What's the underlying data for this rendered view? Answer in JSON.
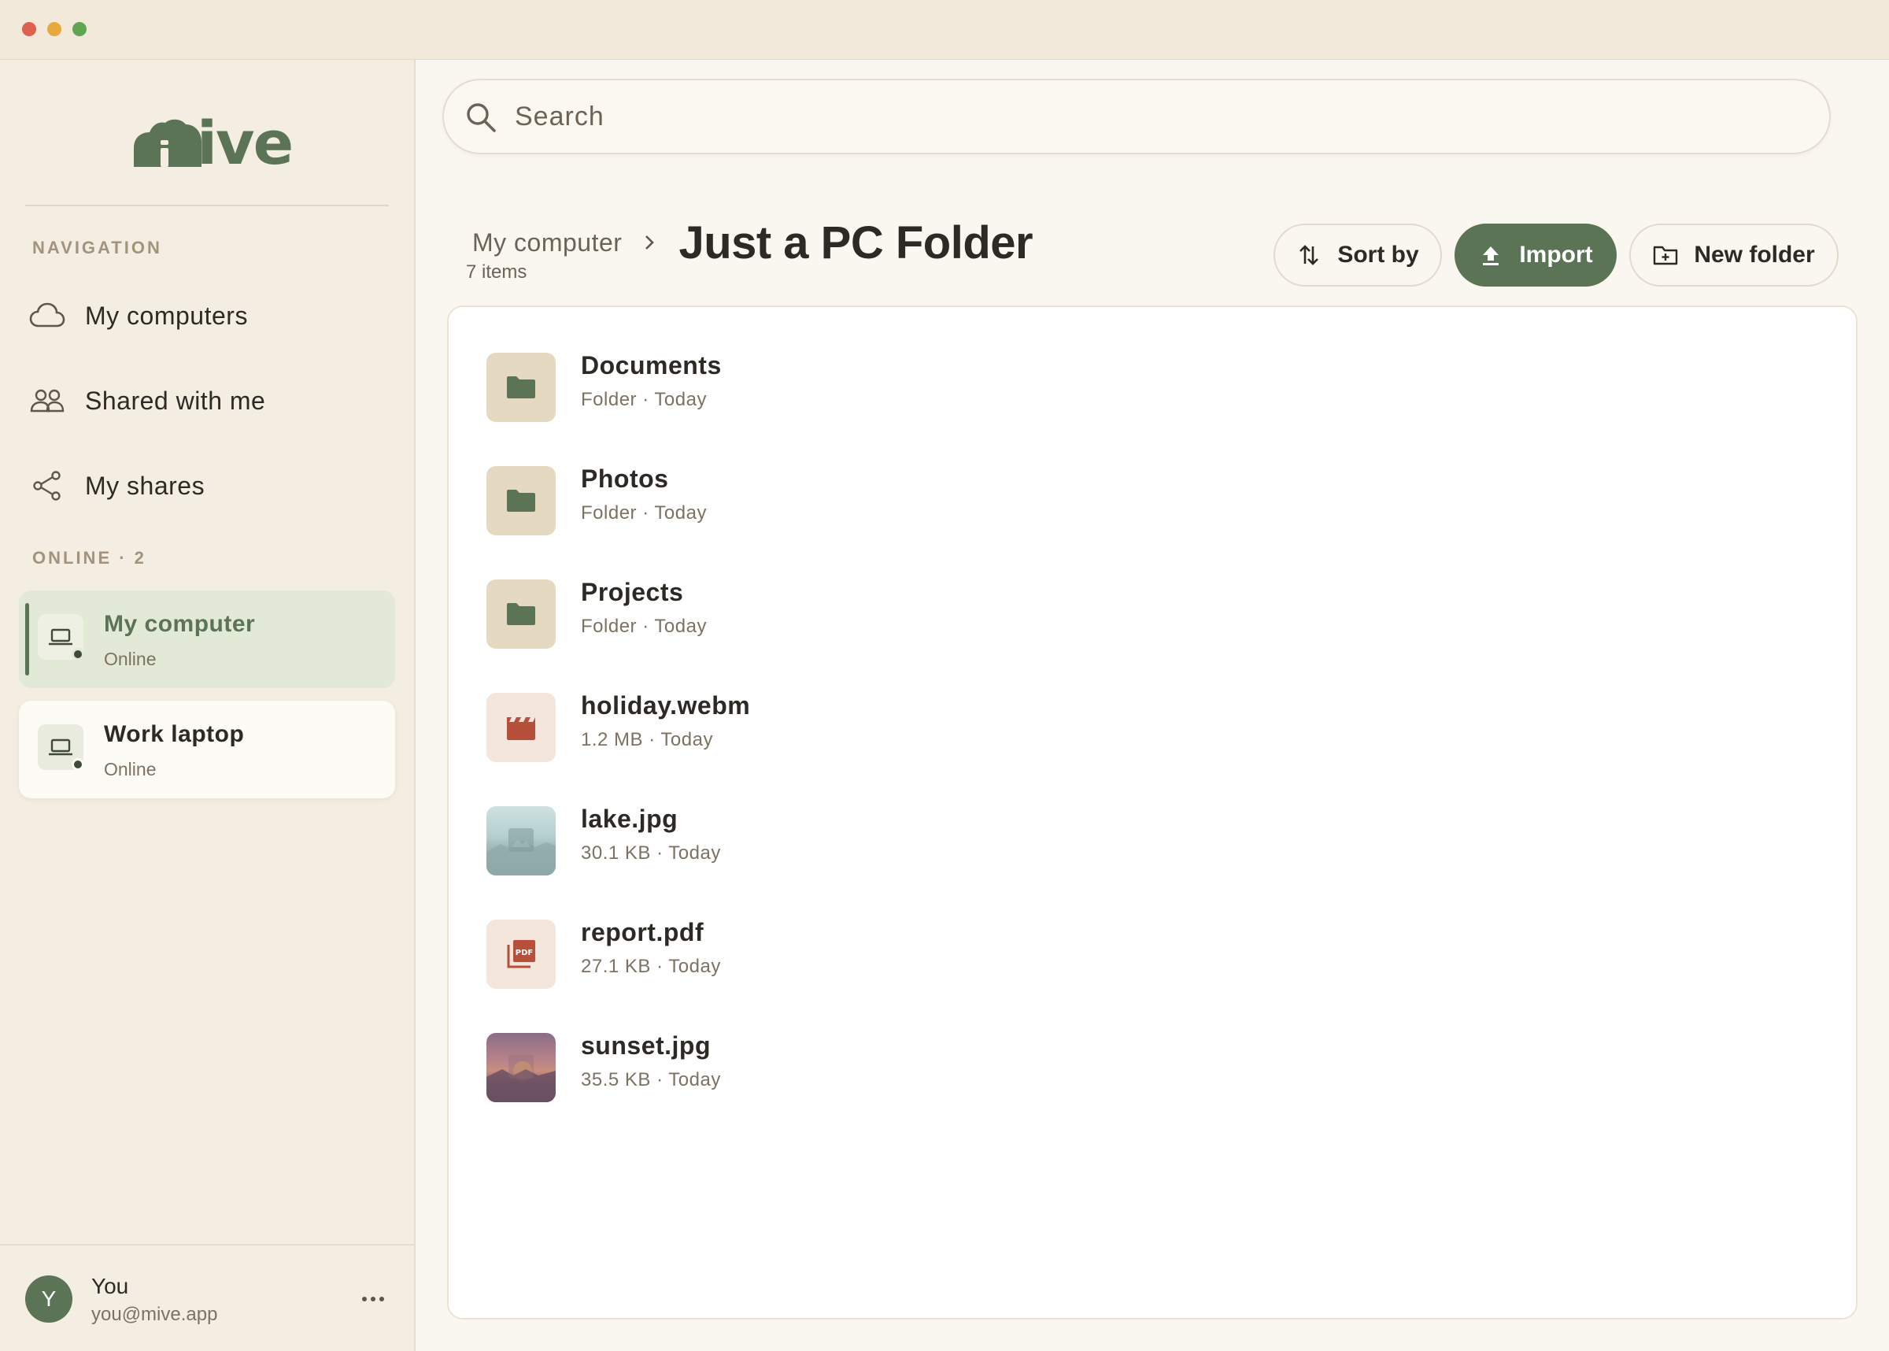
{
  "window": {
    "controls": [
      "close",
      "minimize",
      "maximize"
    ]
  },
  "app": {
    "logo_text": "ive",
    "brand_color": "#5b7455"
  },
  "sidebar": {
    "navigation_label": "NAVIGATION",
    "nav_items": [
      {
        "label": "My computers",
        "icon": "cloud-icon"
      },
      {
        "label": "Shared with me",
        "icon": "people-icon"
      },
      {
        "label": "My shares",
        "icon": "share-icon"
      }
    ],
    "online_label": "ONLINE · 2",
    "devices": [
      {
        "name": "My computer",
        "status": "Online",
        "active": true,
        "icon": "laptop-icon"
      },
      {
        "name": "Work laptop",
        "status": "Online",
        "active": false,
        "icon": "laptop-icon"
      }
    ]
  },
  "user": {
    "avatar_initial": "Y",
    "name": "You",
    "email": "you@mive.app",
    "more_label": "•••"
  },
  "search": {
    "placeholder": "Search",
    "value": ""
  },
  "breadcrumb": {
    "parent": "My computer",
    "current": "Just a PC Folder"
  },
  "item_count": "7 items",
  "toolbar": {
    "sort_label": "Sort by",
    "import_label": "Import",
    "new_folder_label": "New folder"
  },
  "files": [
    {
      "name": "Documents",
      "meta": "Folder · Today",
      "kind": "folder",
      "icon": "folder-icon"
    },
    {
      "name": "Photos",
      "meta": "Folder · Today",
      "kind": "folder",
      "icon": "folder-icon"
    },
    {
      "name": "Projects",
      "meta": "Folder · Today",
      "kind": "folder",
      "icon": "folder-icon"
    },
    {
      "name": "holiday.webm",
      "meta": "1.2 MB · Today",
      "kind": "video",
      "icon": "clapperboard-icon"
    },
    {
      "name": "lake.jpg",
      "meta": "30.1 KB · Today",
      "kind": "image",
      "icon": "image-icon"
    },
    {
      "name": "report.pdf",
      "meta": "27.1 KB · Today",
      "kind": "pdf",
      "icon": "pdf-icon"
    },
    {
      "name": "sunset.jpg",
      "meta": "35.5 KB · Today",
      "kind": "image",
      "icon": "image-icon"
    }
  ]
}
